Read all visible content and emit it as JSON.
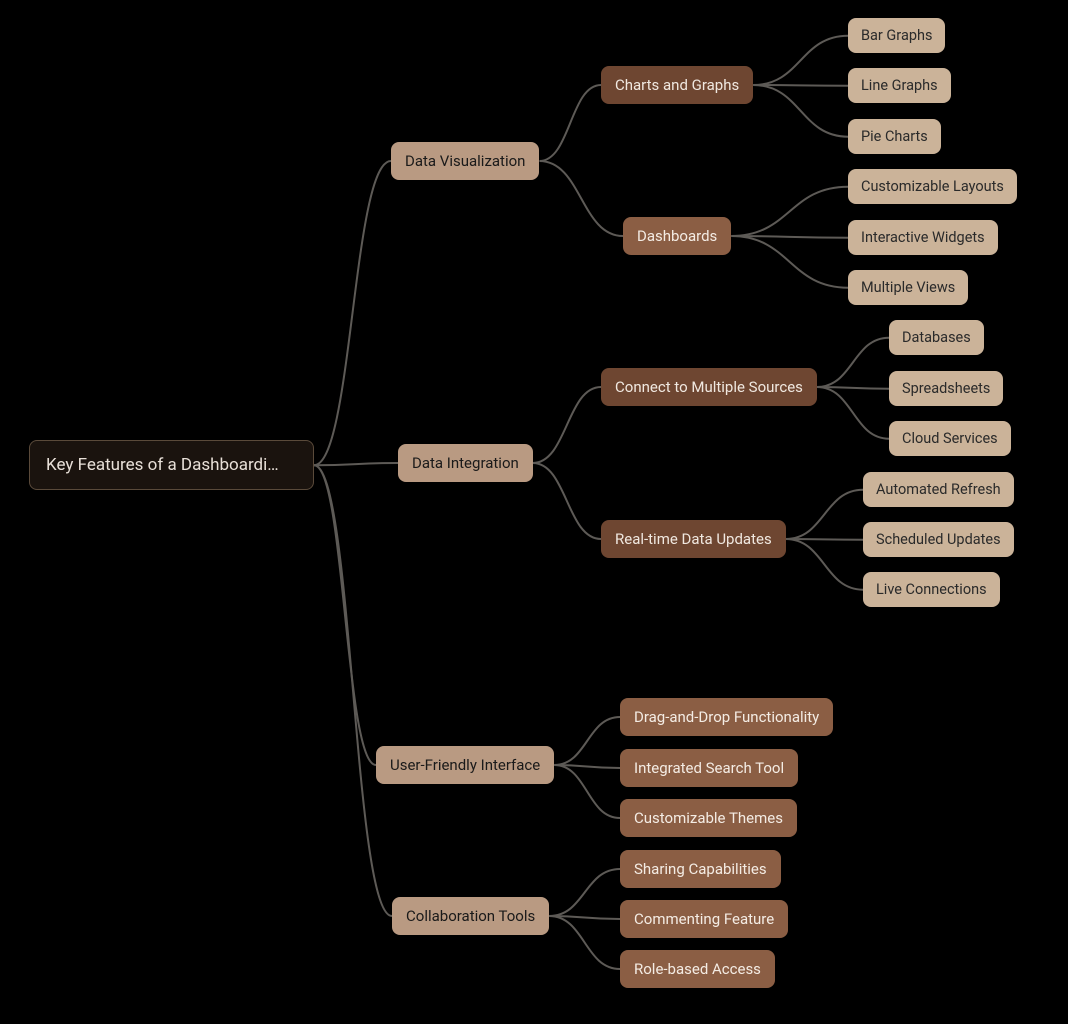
{
  "root": {
    "label": "Key Features of a Dashboardi…"
  },
  "level1": {
    "data_viz": "Data Visualization",
    "data_int": "Data Integration",
    "ui": "User-Friendly Interface",
    "collab": "Collaboration Tools"
  },
  "level2": {
    "charts": "Charts and Graphs",
    "dash": "Dashboards",
    "connect": "Connect to Multiple Sources",
    "realtime": "Real-time Data Updates"
  },
  "leaves": {
    "charts": {
      "a": "Bar Graphs",
      "b": "Line Graphs",
      "c": "Pie Charts"
    },
    "dash": {
      "a": "Customizable Layouts",
      "b": "Interactive Widgets",
      "c": "Multiple Views"
    },
    "connect": {
      "a": "Databases",
      "b": "Spreadsheets",
      "c": "Cloud Services"
    },
    "realtime": {
      "a": "Automated Refresh",
      "b": "Scheduled Updates",
      "c": "Live Connections"
    },
    "ui": {
      "a": "Drag-and-Drop Functionality",
      "b": "Integrated Search Tool",
      "c": "Customizable Themes"
    },
    "collab": {
      "a": "Sharing Capabilities",
      "b": "Commenting Feature",
      "c": "Role-based Access"
    }
  },
  "colors": {
    "link": "#5d5a56"
  }
}
